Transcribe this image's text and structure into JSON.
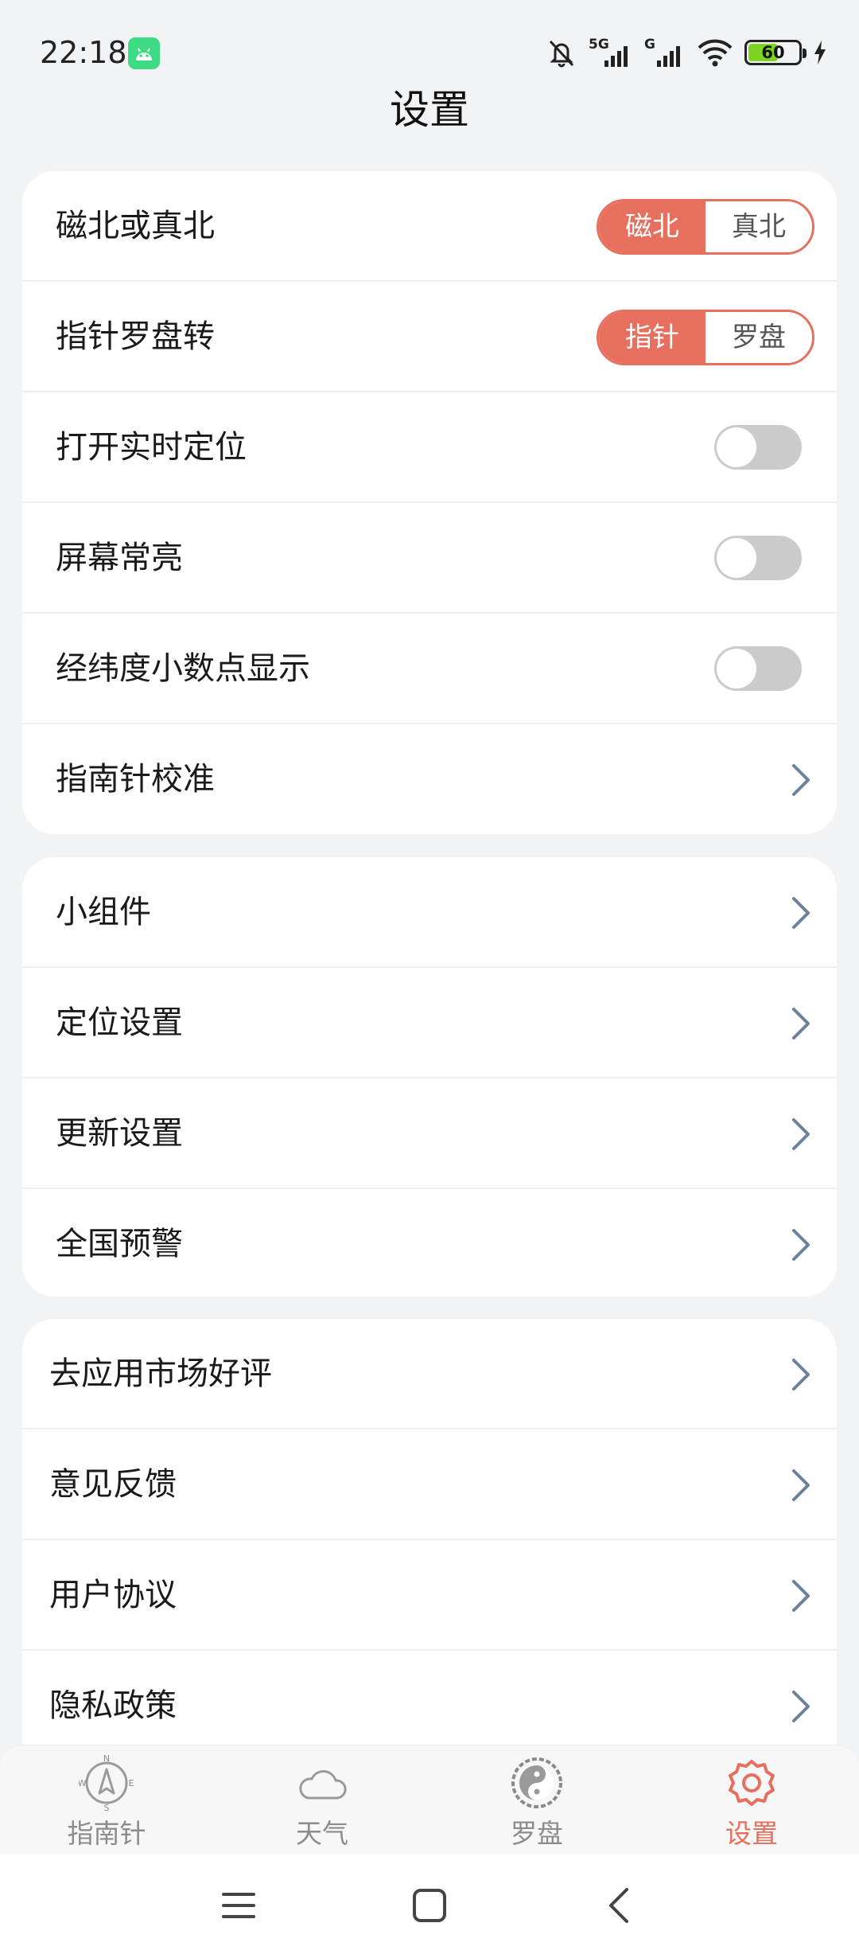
{
  "status_bar": {
    "time": "22:18",
    "signal_1_label": "5G",
    "signal_2_label": "G",
    "battery": "60",
    "battery_level": 0.6
  },
  "header": {
    "title": "设置"
  },
  "section1": {
    "magnetic_or_true_north": {
      "label": "磁北或真北",
      "options": [
        "磁北",
        "真北"
      ],
      "selected": "磁北"
    },
    "pointer_or_dial_rotate": {
      "label": "指针罗盘转",
      "options": [
        "指针",
        "罗盘"
      ],
      "selected": "指针"
    },
    "realtime_location": {
      "label": "打开实时定位",
      "enabled": false
    },
    "keep_screen_on": {
      "label": "屏幕常亮",
      "enabled": false
    },
    "latlng_decimal": {
      "label": "经纬度小数点显示",
      "enabled": false
    },
    "calibrate": {
      "label": "指南针校准"
    }
  },
  "section2": {
    "items": [
      {
        "label": "小组件"
      },
      {
        "label": "定位设置"
      },
      {
        "label": "更新设置"
      },
      {
        "label": "全国预警"
      }
    ]
  },
  "section3": {
    "items": [
      {
        "label": "去应用市场好评"
      },
      {
        "label": "意见反馈"
      },
      {
        "label": "用户协议"
      },
      {
        "label": "隐私政策"
      }
    ]
  },
  "bottom_nav": {
    "items": [
      {
        "label": "指南针",
        "icon": "compass-icon"
      },
      {
        "label": "天气",
        "icon": "cloud-icon"
      },
      {
        "label": "罗盘",
        "icon": "luopan-icon"
      },
      {
        "label": "设置",
        "icon": "gear-icon",
        "active": true
      }
    ]
  },
  "colors": {
    "accent": "#e76f5e",
    "background": "#f2f3f5",
    "chevron": "#6b829c"
  }
}
